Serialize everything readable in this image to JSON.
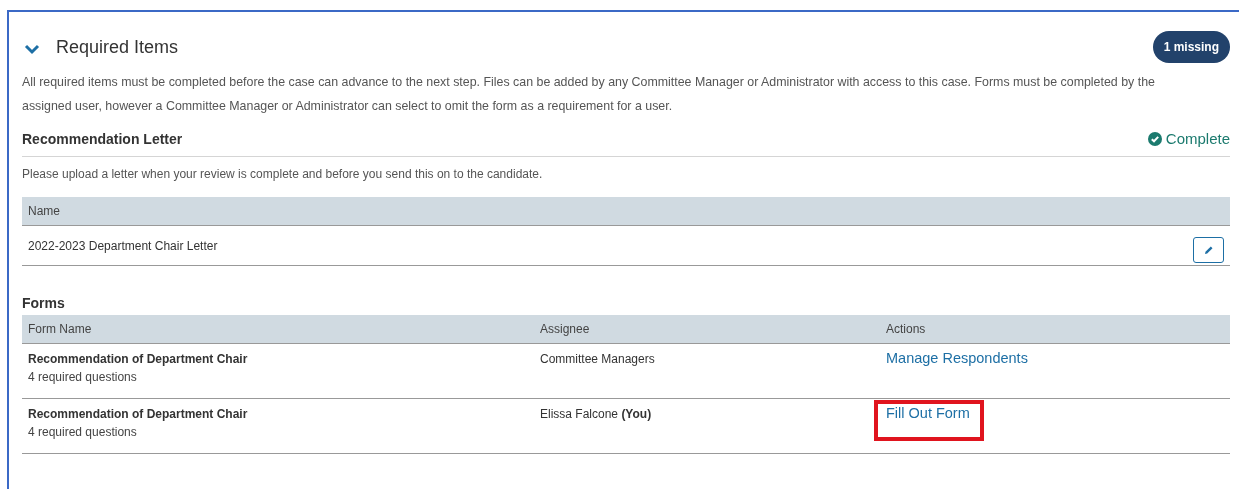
{
  "section": {
    "title": "Required Items",
    "expanded": true,
    "badge": "1 missing",
    "description": "All required items must be completed before the case can advance to the next step. Files can be added by any Committee Manager or Administrator with access to this case. Forms must be completed by the assigned user, however a Committee Manager or Administrator can select to omit the form as a requirement for a user."
  },
  "letter": {
    "title": "Recommendation Letter",
    "status": "Complete",
    "complete": true,
    "instructions": "Please upload a letter when your review is complete and before you send this on to the candidate.",
    "columns": [
      "Name"
    ],
    "rows": [
      {
        "name": "2022-2023 Department Chair Letter"
      }
    ]
  },
  "forms": {
    "title": "Forms",
    "columns": [
      "Form Name",
      "Assignee",
      "Actions"
    ],
    "rows": [
      {
        "name": "Recommendation of Department Chair",
        "detail": "4 required questions",
        "assignee": "Committee Managers",
        "action": "Manage Respondents",
        "highlighted": false
      },
      {
        "name": "Recommendation of Department Chair",
        "detail": "4 required questions",
        "assignee": "Elissa Falcone **(You)**",
        "action": "Fill Out Form",
        "highlighted": true
      }
    ]
  }
}
